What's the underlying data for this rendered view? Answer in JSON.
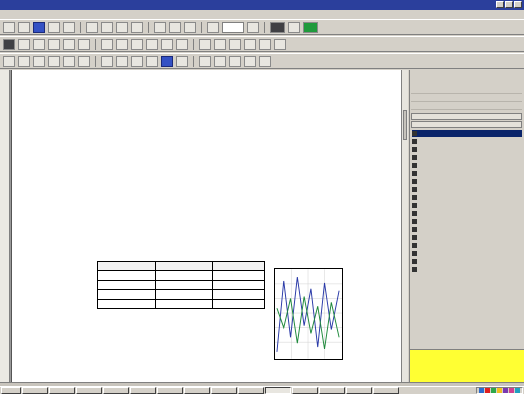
{
  "window": {
    "title": ""
  },
  "menubar": [],
  "form": {
    "left_labels": [
      "",
      "",
      "",
      ""
    ],
    "left_values": [
      "",
      "",
      "",
      ""
    ],
    "right_labels": [
      "",
      "",
      "",
      "",
      ""
    ],
    "right_values": [
      "",
      "",
      "",
      "",
      ""
    ],
    "section_label": "",
    "mid_lines": [
      "",
      "",
      ""
    ],
    "mid_right": [
      "",
      ""
    ],
    "table_label": "",
    "table": {
      "headers": [
        "",
        "",
        ""
      ],
      "rows": [
        [
          "",
          "",
          ""
        ],
        [
          "",
          "",
          ""
        ],
        [
          "",
          "",
          ""
        ],
        [
          "",
          "",
          ""
        ]
      ]
    },
    "bottom_labels": [
      "",
      "",
      ""
    ]
  },
  "panel": {
    "head1": "",
    "head2": "",
    "rows": [
      "",
      "",
      ""
    ],
    "head3": "",
    "head4": "",
    "items": [
      "",
      "",
      "",
      "",
      "",
      "",
      "",
      "",
      "",
      "",
      "",
      "",
      "",
      "",
      "",
      "",
      "",
      ""
    ]
  },
  "statusbar": {
    "text": ""
  },
  "taskbar": {
    "start": "",
    "tasks": [
      "",
      "",
      "",
      "",
      "",
      "",
      "",
      "",
      "",
      "",
      "",
      "",
      "",
      ""
    ],
    "tray_colors": [
      "#2a6cd0",
      "#e02020",
      "#2ea84a",
      "#f0c020",
      "#7a3ab0",
      "#d04090",
      "#20a0c0"
    ]
  },
  "colors": {
    "title_bar": "#2b3f9c",
    "panel_header": "#1a2c8c",
    "chart_line_a": "#2a3aa8",
    "chart_line_b": "#1f8a3c",
    "highlight": "#ffff33"
  }
}
